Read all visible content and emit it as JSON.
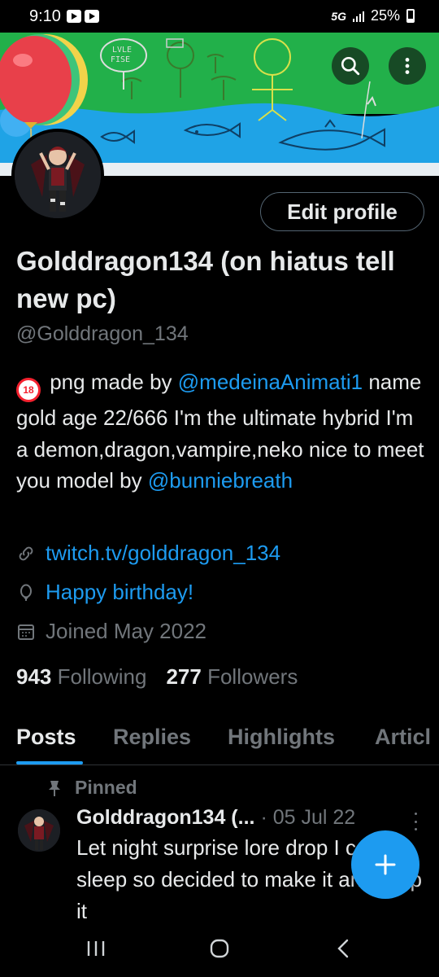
{
  "status_bar": {
    "time": "9:10",
    "network": "5G",
    "battery": "25%"
  },
  "profile": {
    "display_name": "Golddragon134 (on hiatus tell new pc)",
    "handle": "@Golddragon_134",
    "edit_button": "Edit profile",
    "bio": {
      "line1_text": " png made by ",
      "line1_mention": "@medeinaAnimati1",
      "middle_text": "name gold age 22/666 I'm the ultimate hybrid I'm a demon,dragon,vampire,neko nice to meet you model by ",
      "line_end_mention": "@bunniebreath",
      "badge": "18"
    },
    "url": "twitch.tv/golddragon_134",
    "birthday": "Happy birthday!",
    "joined": "Joined May 2022",
    "following_count": "943",
    "following_label": "Following",
    "followers_count": "277",
    "followers_label": "Followers"
  },
  "banner": {
    "sign_text": "LVLE\nFISE"
  },
  "tabs": [
    {
      "label": "Posts",
      "active": true
    },
    {
      "label": "Replies",
      "active": false
    },
    {
      "label": "Highlights",
      "active": false
    },
    {
      "label": "Articl",
      "active": false
    }
  ],
  "pinned_post": {
    "pinned_label": "Pinned",
    "author": "Golddragon134 (...",
    "date": "· 05 Jul 22",
    "text": "Let night surprise lore drop I can't sleep so decided to make it and drop it"
  },
  "colors": {
    "accent": "#1d9bf0",
    "background": "#000000",
    "muted": "#71767b",
    "text": "#e7e9ea"
  },
  "icons": [
    "search-icon",
    "more-icon",
    "link-icon",
    "balloon-icon",
    "calendar-icon",
    "pin-icon",
    "plus-icon",
    "recents-icon",
    "home-icon",
    "back-icon"
  ]
}
